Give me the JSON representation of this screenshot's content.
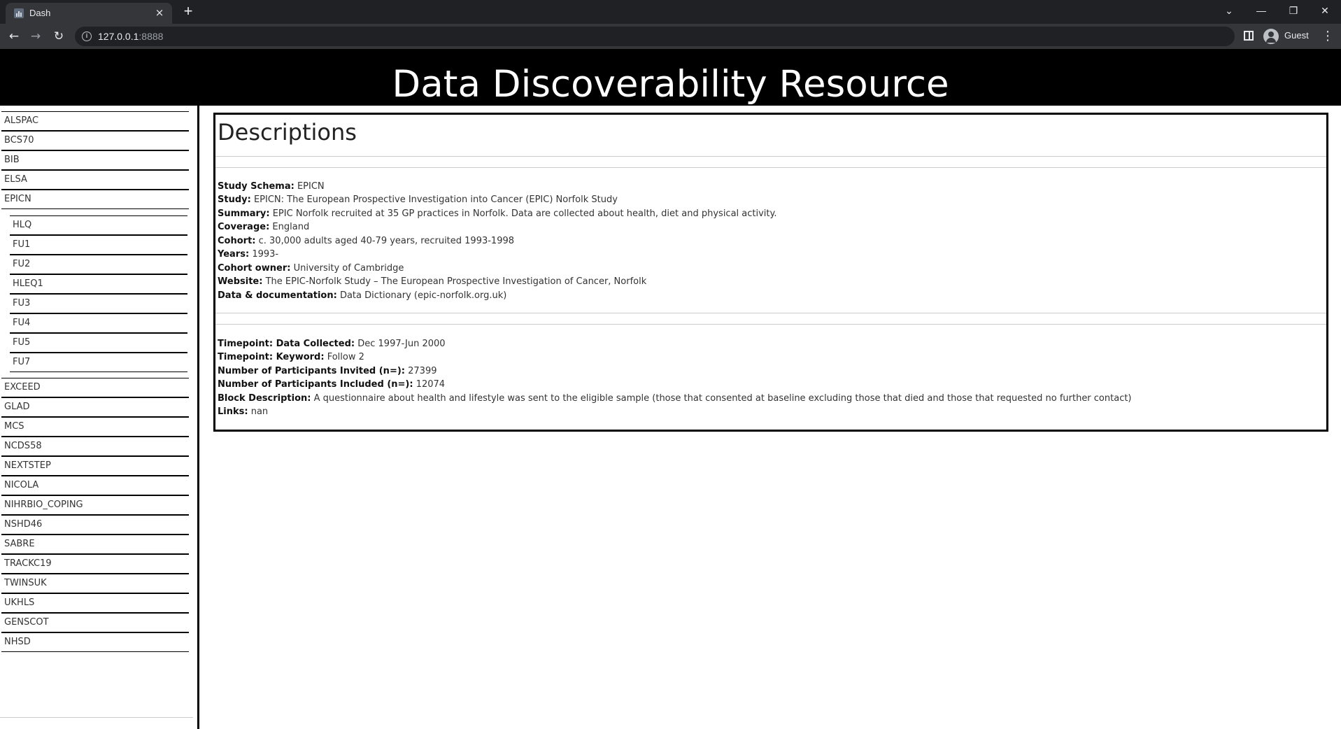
{
  "browser": {
    "tab_title": "Dash",
    "tab_close": "×",
    "new_tab": "+",
    "url_host": "127.0.0.1",
    "url_port": ":8888",
    "profile_name": "Guest",
    "window_controls": {
      "dropdown": "⌄",
      "minimize": "—",
      "restore": "❐",
      "close": "✕"
    }
  },
  "header": {
    "title": "Data Discoverability Resource"
  },
  "sidebar": {
    "items_top": [
      "ALSPAC",
      "BCS70",
      "BIB",
      "ELSA",
      "EPICN"
    ],
    "sub_items": [
      "HLQ",
      "FU1",
      "FU2",
      "HLEQ1",
      "FU3",
      "FU4",
      "FU5",
      "FU7"
    ],
    "items_bottom": [
      "EXCEED",
      "GLAD",
      "MCS",
      "NCDS58",
      "NEXTSTEP",
      "NICOLA",
      "NIHRBIO_COPING",
      "NSHD46",
      "SABRE",
      "TRACKC19",
      "TWINSUK",
      "UKHLS",
      "GENSCOT",
      "NHSD"
    ]
  },
  "descriptions": {
    "title": "Descriptions",
    "study_fields": [
      {
        "label": "Study Schema:",
        "value": "EPICN"
      },
      {
        "label": "Study:",
        "value": "EPICN: The European Prospective Investigation into Cancer (EPIC) Norfolk Study"
      },
      {
        "label": "Summary:",
        "value": "EPIC Norfolk recruited at 35 GP practices in Norfolk. Data are collected about health, diet and physical activity."
      },
      {
        "label": "Coverage:",
        "value": "England"
      },
      {
        "label": "Cohort:",
        "value": "c. 30,000 adults aged 40-79 years, recruited 1993-1998"
      },
      {
        "label": "Years:",
        "value": "1993-"
      },
      {
        "label": "Cohort owner:",
        "value": "University of Cambridge"
      },
      {
        "label": "Website:",
        "value": "The EPIC-Norfolk Study – The European Prospective Investigation of Cancer, Norfolk"
      },
      {
        "label": "Data & documentation:",
        "value": "Data Dictionary (epic-norfolk.org.uk)"
      }
    ],
    "block_fields": [
      {
        "label": "Timepoint: Data Collected:",
        "value": "Dec 1997-Jun 2000"
      },
      {
        "label": "Timepoint: Keyword:",
        "value": "Follow 2"
      },
      {
        "label": "Number of Participants Invited (n=):",
        "value": "27399"
      },
      {
        "label": "Number of Participants Included (n=):",
        "value": "12074"
      },
      {
        "label": "Block Description:",
        "value": "A questionnaire about health and lifestyle was sent to the eligible sample (those that consented at baseline excluding those that died and those that requested no further contact)"
      },
      {
        "label": "Links:",
        "value": "nan"
      }
    ]
  }
}
